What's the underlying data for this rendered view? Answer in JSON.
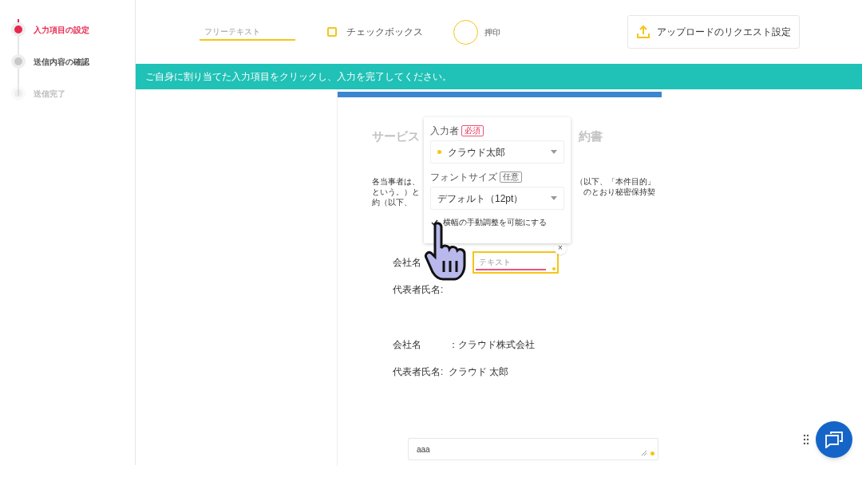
{
  "steps": [
    {
      "label": "入力項目の設定",
      "selected": true,
      "disabled": false
    },
    {
      "label": "送信内容の確認",
      "selected": false,
      "disabled": false
    },
    {
      "label": "送信完了",
      "selected": false,
      "disabled": true
    }
  ],
  "toolbar": {
    "tools": [
      {
        "kind": "text",
        "label": "フリーテキスト"
      },
      {
        "kind": "checkbox",
        "label": "チェックボックス"
      },
      {
        "kind": "stamp",
        "label": "押印"
      }
    ],
    "upload_button": "アップロードのリクエスト設定"
  },
  "banner": "ご自身に割り当てた入力項目をクリックし、入力を完了してください。",
  "document": {
    "title_fragments": [
      "サービス",
      "約書"
    ],
    "paragraph_lines": [
      [
        "各当事者は、",
        "（以下、「本件目的」"
      ],
      [
        "という。）と",
        "のとおり秘密保持契"
      ],
      [
        "約（以下、"
      ]
    ],
    "rows": [
      {
        "kind": "input",
        "label": "会社名",
        "placeholder": "テキスト",
        "close_button": "×"
      },
      {
        "kind": "blank",
        "label": "代表者氏名:"
      },
      {
        "kind": "text",
        "label": "会社名",
        "separator": "：",
        "value": "クラウド株式会社"
      },
      {
        "kind": "text",
        "label": "代表者氏名:",
        "value": "クラウド 太郎"
      }
    ],
    "bottom_field": {
      "value": "aaa"
    }
  },
  "popup": {
    "assignee_label": "入力者",
    "assignee_badge": "必須",
    "assignee": "クラウド太郎",
    "font_size_label": "フォントサイズ",
    "font_size_badge": "任意",
    "font_size": "デフォルト（12pt）",
    "manual_width_label": "横幅の手動調整を可能にする",
    "manual_width_checked": true
  }
}
